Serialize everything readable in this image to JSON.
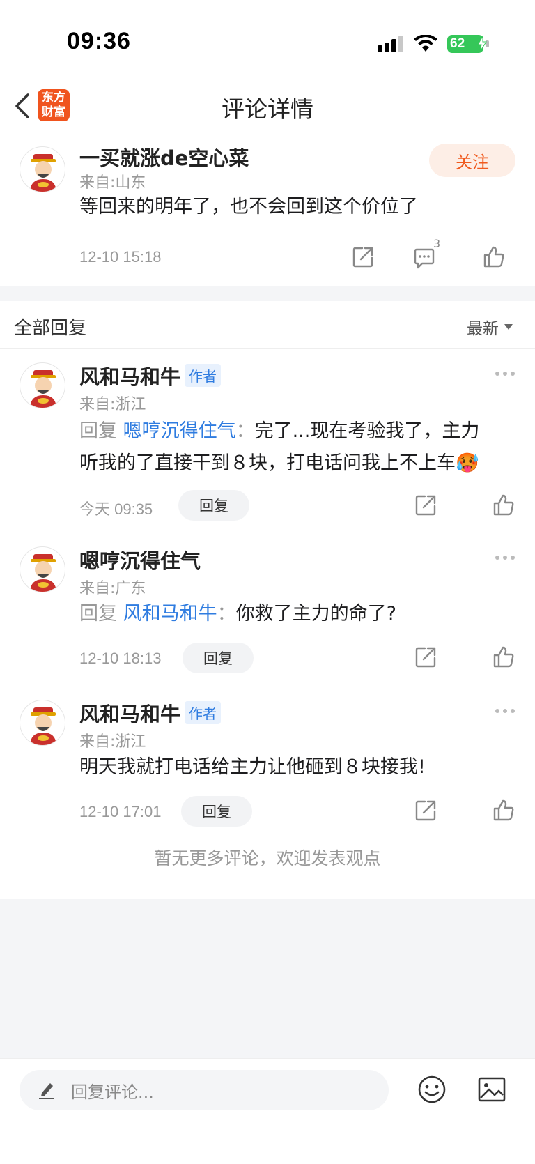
{
  "status_bar": {
    "time": "09:36",
    "battery": "62"
  },
  "nav": {
    "logo_line1": "东方",
    "logo_line2": "财富",
    "title": "评论详情"
  },
  "main_comment": {
    "username": "一买就涨de空心菜",
    "location": "来自:山东",
    "follow_label": "关注",
    "content": "等回来的明年了，也不会回到这个价位了",
    "time": "12-10 15:18",
    "comment_count": "3"
  },
  "section": {
    "title": "全部回复",
    "sort": "最新"
  },
  "replies": [
    {
      "username": "风和马和牛",
      "badge": "作者",
      "location": "来自:浙江",
      "reply_prefix": "回复",
      "mention": "嗯哼沉得住气",
      "separator": "：",
      "content": "完了...现在考验我了，主力听我的了直接干到８块，打电话问我上不上车",
      "emoji": "🥵",
      "time": "今天 09:35",
      "reply_label": "回复"
    },
    {
      "username": "嗯哼沉得住气",
      "location": "来自:广东",
      "reply_prefix": "回复",
      "mention": "风和马和牛",
      "separator": "：",
      "content": "你救了主力的命了?",
      "time": "12-10 18:13",
      "reply_label": "回复"
    },
    {
      "username": "风和马和牛",
      "badge": "作者",
      "location": "来自:浙江",
      "content": "明天我就打电话给主力让他砸到８块接我!",
      "time": "12-10 17:01",
      "reply_label": "回复"
    }
  ],
  "no_more_text": "暂无更多评论，欢迎发表观点",
  "bottom_bar": {
    "placeholder": "回复评论..."
  },
  "colors": {
    "accent": "#f05a1e",
    "link": "#2f7ce0",
    "badge_bg": "#e8f1fd"
  }
}
